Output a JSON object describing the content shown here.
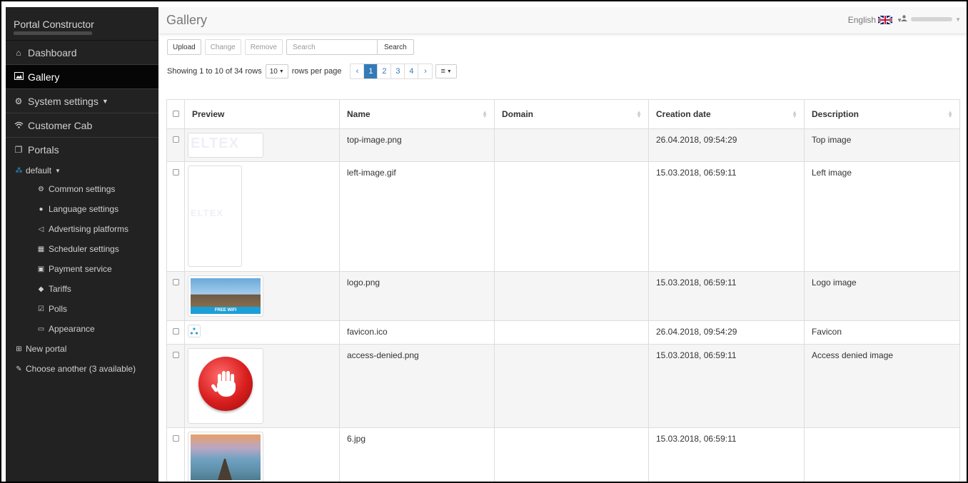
{
  "sidebar": {
    "brand": "Portal Constructor",
    "items": [
      {
        "label": "Dashboard",
        "icon": "home-icon"
      },
      {
        "label": "Gallery",
        "icon": "image-icon",
        "active": true
      },
      {
        "label": "System settings",
        "icon": "cogs-icon"
      },
      {
        "label": "Customer Cab",
        "icon": "wifi-icon"
      },
      {
        "label": "Portals",
        "icon": "copy-icon"
      }
    ],
    "portal": {
      "label": "default",
      "icon": "sitemap-icon"
    },
    "portal_items": [
      {
        "label": "Common settings",
        "icon": "cog-icon"
      },
      {
        "label": "Language settings",
        "icon": "globe-icon"
      },
      {
        "label": "Advertising platforms",
        "icon": "bullhorn-icon"
      },
      {
        "label": "Scheduler settings",
        "icon": "calendar-icon"
      },
      {
        "label": "Payment service",
        "icon": "money-icon"
      },
      {
        "label": "Tariffs",
        "icon": "tag-icon"
      },
      {
        "label": "Polls",
        "icon": "check-square-icon"
      },
      {
        "label": "Appearance",
        "icon": "desktop-icon"
      }
    ],
    "new_portal": "New portal",
    "choose_another": "Choose another (3 available)"
  },
  "header": {
    "title": "Gallery",
    "language": "English"
  },
  "toolbar": {
    "upload": "Upload",
    "change": "Change",
    "remove": "Remove",
    "search_placeholder": "Search",
    "search_button": "Search"
  },
  "pagination": {
    "showing": "Showing 1 to 10 of 34 rows",
    "rows_per_page_value": "10",
    "rows_per_page_label": "rows per page",
    "prev": "‹",
    "pages": [
      "1",
      "2",
      "3",
      "4"
    ],
    "current_page": "1",
    "next": "›",
    "columns_icon": "≡"
  },
  "table": {
    "columns": [
      "Preview",
      "Name",
      "Domain",
      "Creation date",
      "Description"
    ],
    "rows": [
      {
        "name": "top-image.png",
        "domain": "",
        "date": "26.04.2018, 09:54:29",
        "description": "Top image",
        "preview": "eltex-logo-wide"
      },
      {
        "name": "left-image.gif",
        "domain": "",
        "date": "15.03.2018, 06:59:11",
        "description": "Left image",
        "preview": "eltex-logo-tall"
      },
      {
        "name": "logo.png",
        "domain": "",
        "date": "15.03.2018, 06:59:11",
        "description": "Logo image",
        "preview": "building-free-wifi"
      },
      {
        "name": "favicon.ico",
        "domain": "",
        "date": "26.04.2018, 09:54:29",
        "description": "Favicon",
        "preview": "favicon"
      },
      {
        "name": "access-denied.png",
        "domain": "",
        "date": "15.03.2018, 06:59:11",
        "description": "Access denied image",
        "preview": "stop-hand"
      },
      {
        "name": "6.jpg",
        "domain": "",
        "date": "15.03.2018, 06:59:11",
        "description": "",
        "preview": "pier-sunset"
      }
    ],
    "thumb_text": {
      "eltex": "ELTEX",
      "free_wifi": "FREE WIFI"
    }
  },
  "colors": {
    "sidebar_bg": "#222222",
    "active_bg": "#060606",
    "accent": "#337ab7",
    "portal_icon": "#2c9ddb"
  }
}
